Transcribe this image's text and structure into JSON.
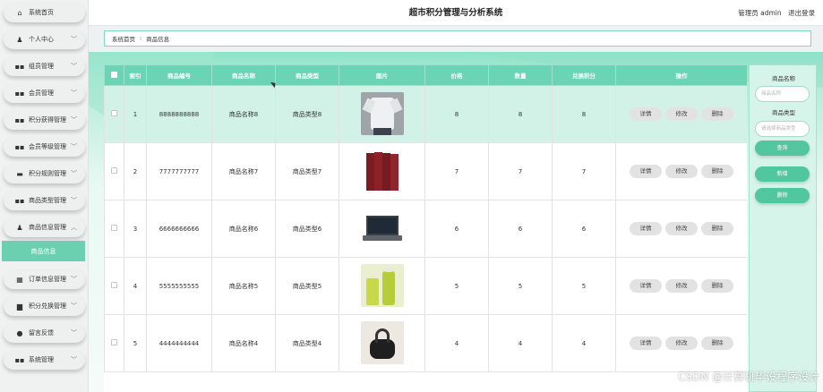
{
  "header": {
    "title": "超市积分管理与分析系统",
    "user": "管理员 admin",
    "logout": "退出登录"
  },
  "breadcrumb": {
    "home": "系统首页",
    "separator": "⁝",
    "current": "商品信息"
  },
  "sidebar": {
    "items": [
      {
        "label": "系统首页",
        "icon": "home-icon",
        "glyph": "⌂",
        "chevron": false
      },
      {
        "label": "个人中心",
        "icon": "user-icon",
        "glyph": "♟",
        "chevron": true
      },
      {
        "label": "组员管理",
        "icon": "grid-icon",
        "glyph": "▪▪",
        "chevron": true
      },
      {
        "label": "会员管理",
        "icon": "grid-icon",
        "glyph": "▪▪",
        "chevron": true
      },
      {
        "label": "积分获得管理",
        "icon": "grid-icon",
        "glyph": "▪▪",
        "chevron": true
      },
      {
        "label": "会员等级管理",
        "icon": "grid-icon",
        "glyph": "▪▪",
        "chevron": true
      },
      {
        "label": "积分规则管理",
        "icon": "archive-icon",
        "glyph": "▬",
        "chevron": true
      },
      {
        "label": "商品类型管理",
        "icon": "grid-icon",
        "glyph": "▪▪",
        "chevron": true
      },
      {
        "label": "商品信息管理",
        "icon": "user-icon",
        "glyph": "♟",
        "chevron": true,
        "expanded": true
      },
      {
        "label": "订单信息管理",
        "icon": "table-icon",
        "glyph": "▦",
        "chevron": true
      },
      {
        "label": "积分兑换管理",
        "icon": "document-icon",
        "glyph": "▆",
        "chevron": true
      },
      {
        "label": "留言反馈",
        "icon": "location-icon",
        "glyph": "●",
        "chevron": true
      },
      {
        "label": "系统管理",
        "icon": "grid-icon",
        "glyph": "▪▪",
        "chevron": true
      }
    ],
    "sub_item": "商品信息"
  },
  "table": {
    "columns": [
      "索引",
      "商品编号",
      "商品名称",
      "商品类型",
      "图片",
      "价格",
      "数量",
      "兑换积分",
      "操作"
    ],
    "rows": [
      {
        "index": "1",
        "code": "8888888888",
        "name": "商品名称8",
        "type": "商品类型8",
        "image": "tshirt-image",
        "price": "8",
        "qty": "8",
        "points": "8",
        "selected": true
      },
      {
        "index": "2",
        "code": "7777777777",
        "name": "商品名称7",
        "type": "商品类型7",
        "image": "books-image",
        "price": "7",
        "qty": "7",
        "points": "7",
        "selected": false
      },
      {
        "index": "3",
        "code": "6666666666",
        "name": "商品名称6",
        "type": "商品类型6",
        "image": "laptop-image",
        "price": "6",
        "qty": "6",
        "points": "6",
        "selected": false
      },
      {
        "index": "4",
        "code": "5555555555",
        "name": "商品名称5",
        "type": "商品类型5",
        "image": "juice-image",
        "price": "5",
        "qty": "5",
        "points": "5",
        "selected": false
      },
      {
        "index": "5",
        "code": "4444444444",
        "name": "商品名称4",
        "type": "商品类型4",
        "image": "handbag-image",
        "price": "4",
        "qty": "4",
        "points": "4",
        "selected": false
      }
    ],
    "actions": {
      "detail": "详情",
      "edit": "修改",
      "delete": "删除"
    }
  },
  "search": {
    "name_label": "商品名称",
    "name_placeholder": "商品名称",
    "type_label": "商品类型",
    "type_placeholder": "请选择商品类型",
    "query_button": "查询",
    "add_button": "新增",
    "delete_button": "删除"
  },
  "watermark": "CSDN @计算机毕设程序设计",
  "colors": {
    "accent": "#6bd4b4",
    "button_green": "#52c69e",
    "selected_row": "#d3f2e7"
  }
}
